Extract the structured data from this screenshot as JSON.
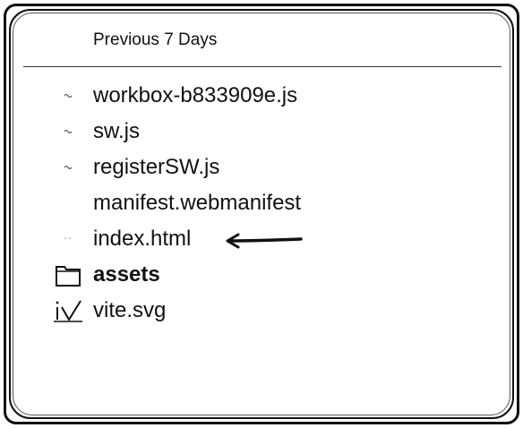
{
  "list": {
    "section_header": "Previous 7 Days",
    "items": [
      {
        "name": "workbox-b833909e.js",
        "icon": "script-file-icon",
        "bold": false
      },
      {
        "name": "sw.js",
        "icon": "script-file-icon",
        "bold": false
      },
      {
        "name": "registerSW.js",
        "icon": "script-file-icon",
        "bold": false
      },
      {
        "name": "manifest.webmanifest",
        "icon": "blank-file-icon",
        "bold": false
      },
      {
        "name": "index.html",
        "icon": "html-file-icon",
        "bold": false
      },
      {
        "name": "assets",
        "icon": "folder-icon",
        "bold": true
      },
      {
        "name": "vite.svg",
        "icon": "svg-file-icon",
        "bold": false
      }
    ]
  },
  "annotation": {
    "arrow_target": "index.html",
    "color": "#111111"
  }
}
